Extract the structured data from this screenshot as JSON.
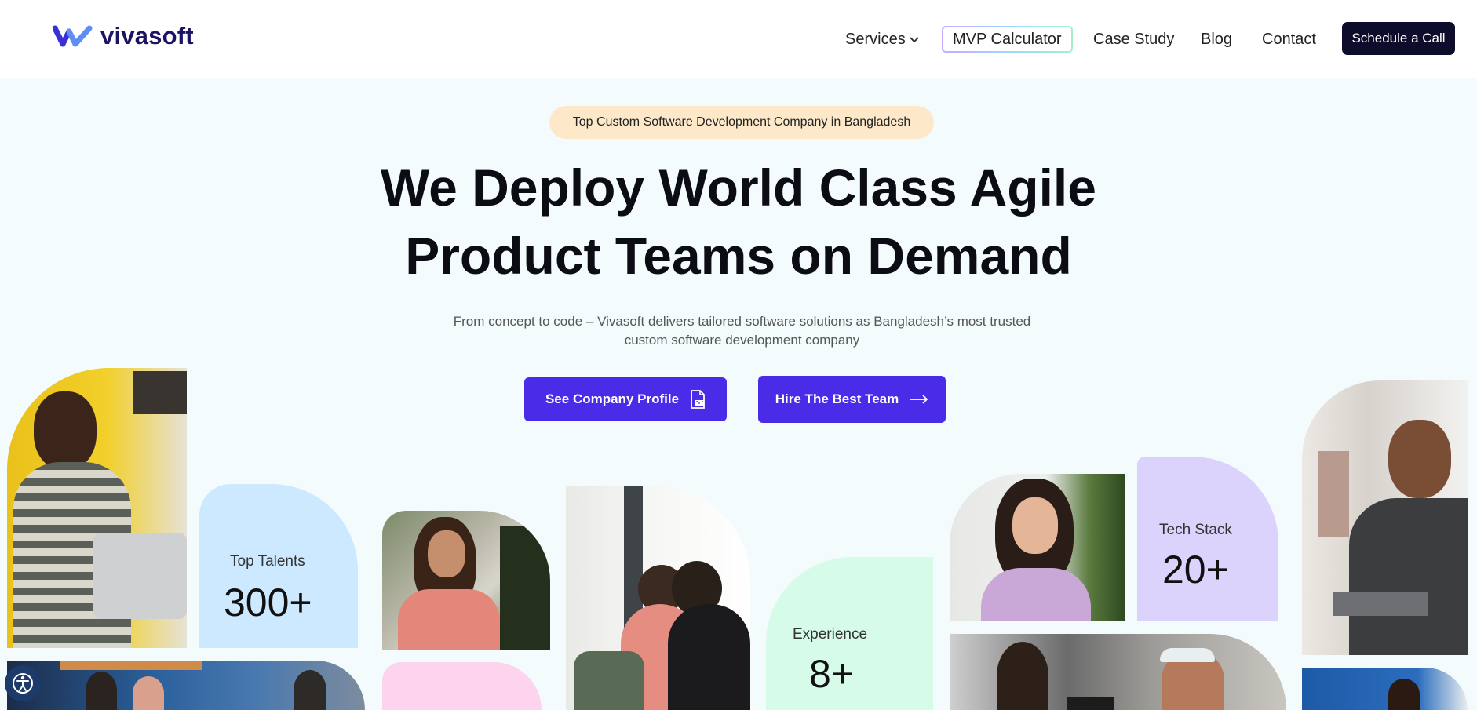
{
  "header": {
    "logo_text": "vivasoft",
    "nav": {
      "services": "Services",
      "mvp": "MVP Calculator",
      "case_study": "Case Study",
      "blog": "Blog",
      "contact": "Contact",
      "cta": "Schedule a Call"
    }
  },
  "hero": {
    "badge": "Top Custom Software Development Company in Bangladesh",
    "title_line1": "We Deploy World Class Agile",
    "title_line2": "Product Teams on Demand",
    "subtitle": "From concept to code – Vivasoft delivers tailored software solutions as Bangladesh’s most trusted custom software development company",
    "btn_profile": "See Company Profile",
    "btn_hire": "Hire The Best Team"
  },
  "stats": {
    "talents_label": "Top Talents",
    "talents_value": "300+",
    "experience_label": "Experience",
    "experience_value": "8+",
    "tech_label": "Tech Stack",
    "tech_value": "20+"
  },
  "colors": {
    "brand": "#4a2be8",
    "navy": "#0d0c2b",
    "badge_bg": "#fde9c9",
    "talents_bg": "#cde9ff",
    "experience_bg": "#d6fbe9",
    "tech_bg": "#dcd3fd"
  },
  "icons": [
    "vivasoft-logo-icon",
    "chevron-down-icon",
    "pdf-icon",
    "arrow-right-icon",
    "accessibility-icon"
  ]
}
